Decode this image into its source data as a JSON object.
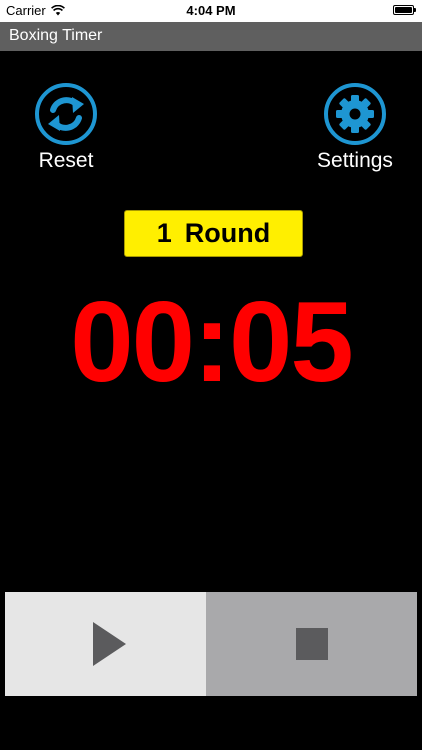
{
  "status_bar": {
    "carrier": "Carrier",
    "time": "4:04 PM"
  },
  "title_bar": {
    "title": "Boxing Timer"
  },
  "controls": {
    "reset_label": "Reset",
    "settings_label": "Settings"
  },
  "round": {
    "number": "1",
    "label": "Round"
  },
  "timer": {
    "display": "00:05"
  },
  "colors": {
    "accent_icon": "#1e96d2",
    "round_badge": "#ffef00",
    "time_text": "#ff0000",
    "title_bar": "#5f5f5f"
  },
  "icons": {
    "reset": "refresh-icon",
    "settings": "gear-icon",
    "play": "play-icon",
    "stop": "stop-icon"
  }
}
